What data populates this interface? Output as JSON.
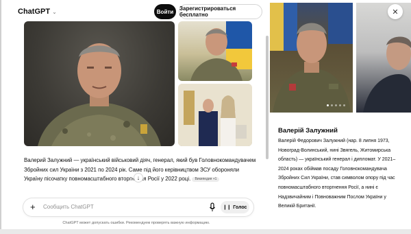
{
  "header": {
    "brand": "ChatGPT",
    "login_label": "Войти",
    "signup_label": "Зарегистрироваться бесплатно"
  },
  "answer": {
    "text_part1": "Валерий Залужний — український військовий діяч, генерал, який був Головнокомандувачем Збройних сил України з 2021 по 2024 рік. Саме під його керівництвом ЗСУ обороняли Україну піс",
    "text_part2": "очатку повномасштабного вторгнення Росії у 2022 році.",
    "source_pill": "Википедия +1"
  },
  "composer": {
    "placeholder": "Сообщить ChatGPT",
    "voice_label": "Голос"
  },
  "disclaimer": "ChatGPT может допускать ошибки. Рекомендуем проверять важную информацию.",
  "side_panel": {
    "title": "Валерій Залужний",
    "description": "Валерій Федорович Залужний (нар. 8 липня 1973, Новоград-Волинський, нині Звягель, Житомирська область) — український генерал і дипломат. У 2021–2024 роках обіймав посаду Головнокомандувача Збройних Сил України, став символом опору під час повномасштабного вторгнення Росії, а нині є Надзвичайним і Повноважним Послом України у Великій Британії."
  },
  "colors": {
    "primary_button": "#0d0d0d",
    "surface": "#ffffff",
    "muted_text": "#8f8f8f"
  }
}
